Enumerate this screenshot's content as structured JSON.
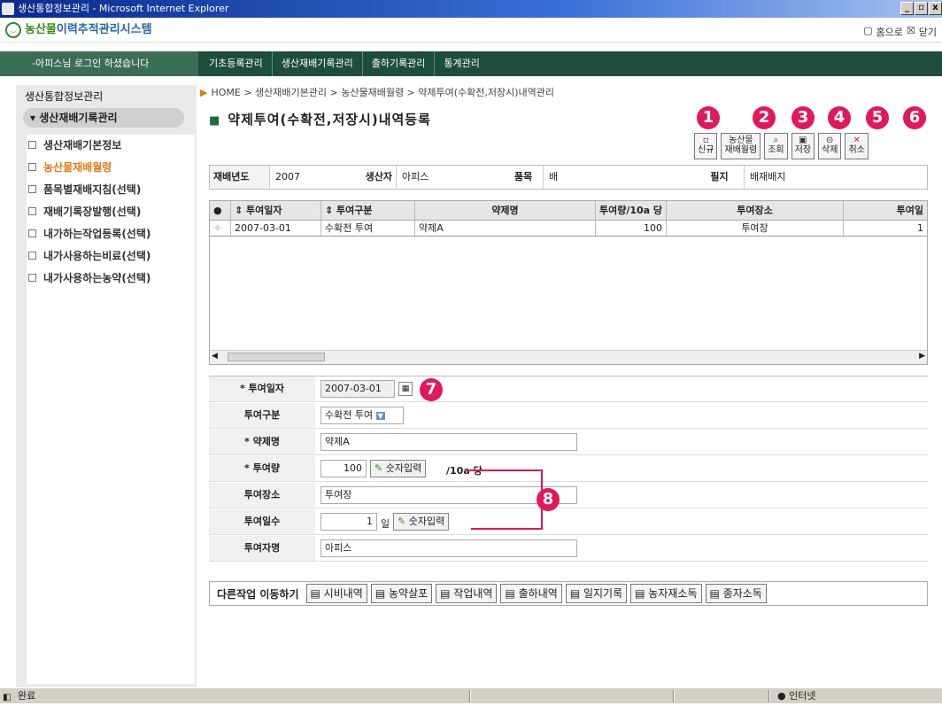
{
  "window": {
    "title": "생산통합정보관리 - Microsoft Internet Explorer",
    "controls": [
      "_",
      "▫",
      "x"
    ]
  },
  "app": {
    "brand_a": "농산물",
    "brand_b": "이력추적관리시스템",
    "home": "홈으로",
    "close": "닫기"
  },
  "login": "-아피스님 로그인 하셨습니다",
  "menus": [
    "기초등록관리",
    "생산재배기록관리",
    "출하기록관리",
    "통계관리"
  ],
  "sidebar": {
    "title": "생산통합정보관리",
    "active": "생산재배기록관리",
    "items": [
      "생산재배기본정보",
      "농산물재배월령",
      "품목별재배지침(선택)",
      "재배기록장발행(선택)",
      "내가하는작업등록(선택)",
      "내가사용하는비료(선택)",
      "내가사용하는농약(선택)"
    ],
    "selected_index": 1
  },
  "breadcrumb": "HOME > 생산재배기본관리 > 농산물재배월령 > 약제투여(수확전,저장시)내역관리",
  "page_title": "약제투여(수확전,저장시)내역등록",
  "toolbar": {
    "new": "신규",
    "monthly_a": "농산물",
    "monthly_b": "재배월령",
    "search": "조회",
    "save": "저장",
    "delete": "삭제",
    "cancel": "취소",
    "markers": [
      "1",
      "2",
      "3",
      "4",
      "5",
      "6"
    ]
  },
  "info": {
    "year_label": "재배년도",
    "year": "2007",
    "producer_label": "생산자",
    "producer": "아피스",
    "item_label": "품목",
    "item": "배",
    "field_label": "필지",
    "field": "배재배지"
  },
  "grid": {
    "headers": [
      "투여일자",
      "투여구분",
      "약제명",
      "투여량/10a 당",
      "투여장소",
      "투여일"
    ],
    "rows": [
      {
        "date": "2007-03-01",
        "type": "수확전 투여",
        "drug": "약제A",
        "amount": "100",
        "place": "투여장",
        "days": "1"
      }
    ]
  },
  "form": {
    "date_label": "* 투여일자",
    "date": "2007-03-01",
    "type_label": "투여구분",
    "type": "수확전 투여",
    "drug_label": "* 약제명",
    "drug": "약제A",
    "amount_label": "* 투여량",
    "amount": "100",
    "num_input": "숫자입력",
    "amount_unit": "/10a 당",
    "place_label": "투여장소",
    "place": "투여장",
    "days_label": "투여일수",
    "days": "1",
    "days_unit": "일",
    "person_label": "투여자명",
    "person": "아피스",
    "markers": [
      "7",
      "8"
    ]
  },
  "other": {
    "label": "다른작업 이동하기",
    "buttons": [
      "시비내역",
      "농약살포",
      "작업내역",
      "출하내역",
      "일지기록",
      "농자재소독",
      "종자소독"
    ]
  },
  "status": {
    "left": "완료",
    "right": "인터넷"
  }
}
